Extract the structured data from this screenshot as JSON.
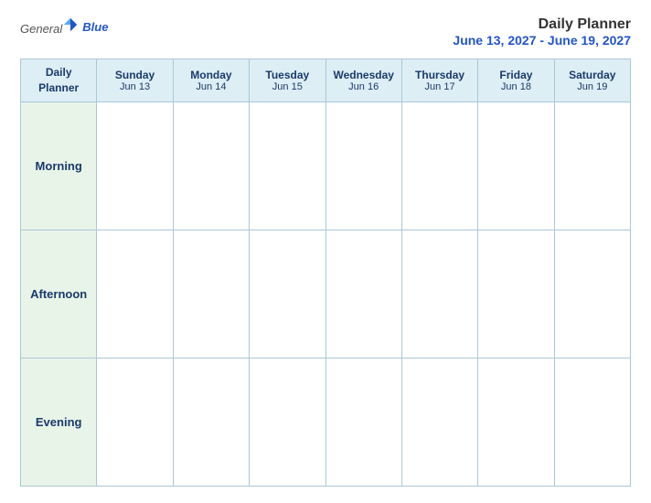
{
  "logo": {
    "general": "General",
    "blue": "Blue",
    "icon_alt": "GeneralBlue logo"
  },
  "header": {
    "title": "Daily Planner",
    "date_range": "June 13, 2027 - June 19, 2027"
  },
  "calendar": {
    "columns": [
      {
        "id": "planner",
        "name": "Daily",
        "name2": "Planner",
        "date": ""
      },
      {
        "id": "sunday",
        "name": "Sunday",
        "date": "Jun 13"
      },
      {
        "id": "monday",
        "name": "Monday",
        "date": "Jun 14"
      },
      {
        "id": "tuesday",
        "name": "Tuesday",
        "date": "Jun 15"
      },
      {
        "id": "wednesday",
        "name": "Wednesday",
        "date": "Jun 16"
      },
      {
        "id": "thursday",
        "name": "Thursday",
        "date": "Jun 17"
      },
      {
        "id": "friday",
        "name": "Friday",
        "date": "Jun 18"
      },
      {
        "id": "saturday",
        "name": "Saturday",
        "date": "Jun 19"
      }
    ],
    "rows": [
      {
        "id": "morning",
        "label": "Morning"
      },
      {
        "id": "afternoon",
        "label": "Afternoon"
      },
      {
        "id": "evening",
        "label": "Evening"
      }
    ]
  }
}
